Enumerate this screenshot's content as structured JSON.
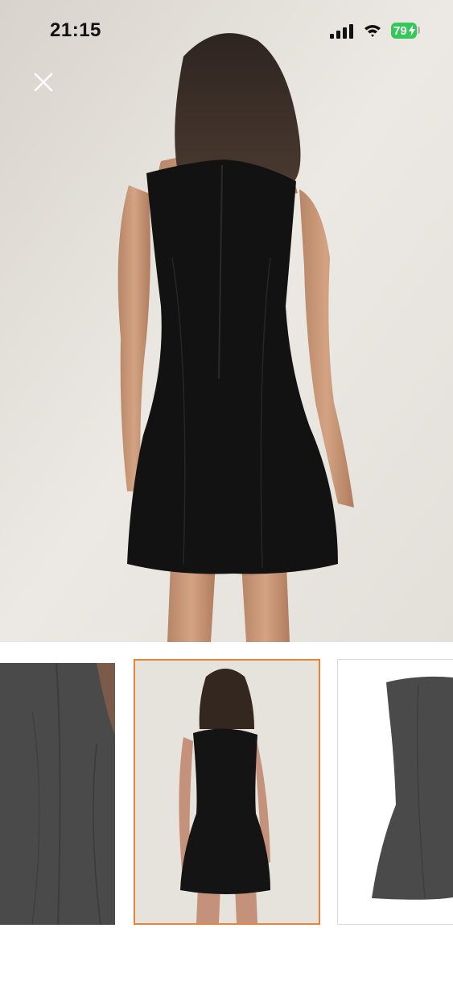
{
  "status_bar": {
    "time": "21:15",
    "battery_level": "79",
    "battery_color": "#34c759",
    "icons": [
      "signal-icon",
      "wifi-icon",
      "battery-icon"
    ]
  },
  "viewer": {
    "close_icon": "close-icon",
    "selected_thumbnail_index": 1,
    "selected_border_color": "#e8843a",
    "thumbnails": [
      {
        "description_icon": "dress-detail-photo"
      },
      {
        "description_icon": "dress-back-photo"
      },
      {
        "description_icon": "dress-side-photo"
      }
    ]
  }
}
